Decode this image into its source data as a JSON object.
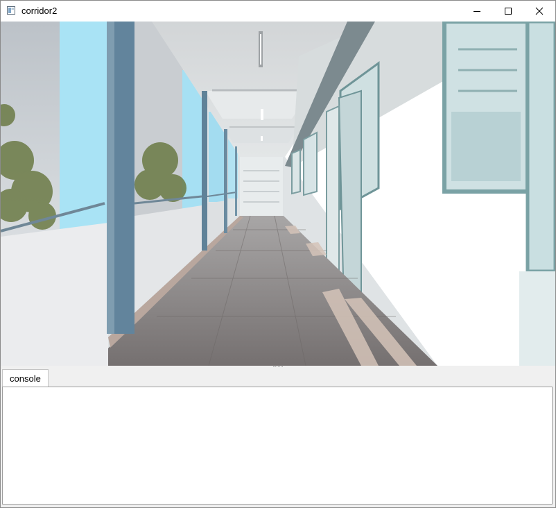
{
  "window": {
    "title": "corridor2",
    "icon": "app-window-icon",
    "controls": [
      "minimize-icon",
      "maximize-icon",
      "close-icon"
    ]
  },
  "viewport": {
    "description_icon": "3d-scene"
  },
  "tabs": [
    {
      "label": "console",
      "selected": true
    }
  ],
  "console": {
    "text": ""
  },
  "colors": {
    "titlebar": "#ffffff",
    "window_bg": "#f0f0f0",
    "sky": "#a9e3f5",
    "column": "#62849c",
    "floor": "#7d7674"
  }
}
